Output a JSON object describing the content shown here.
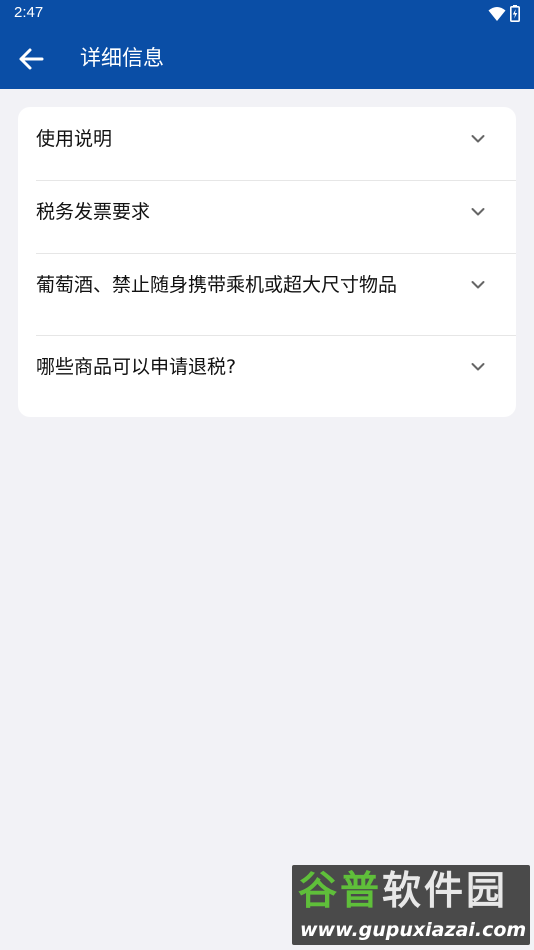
{
  "status_bar": {
    "time": "2:47",
    "icons": [
      "wifi-icon",
      "battery-charging-icon"
    ]
  },
  "app_bar": {
    "back_icon": "arrow-left-icon",
    "title": "详细信息",
    "color": "#0a4ea6"
  },
  "accordion": {
    "items": [
      {
        "label": "使用说明",
        "icon": "chevron-down-icon"
      },
      {
        "label": "税务发票要求",
        "icon": "chevron-down-icon"
      },
      {
        "label": "葡萄酒、禁止随身携带乘机或超大尺寸物品",
        "icon": "chevron-down-icon"
      },
      {
        "label": "哪些商品可以申请退税?",
        "icon": "chevron-down-icon"
      }
    ]
  },
  "watermark": {
    "part1": "谷普",
    "part2": "软件园",
    "url": "www.gupuxiazai.com"
  }
}
